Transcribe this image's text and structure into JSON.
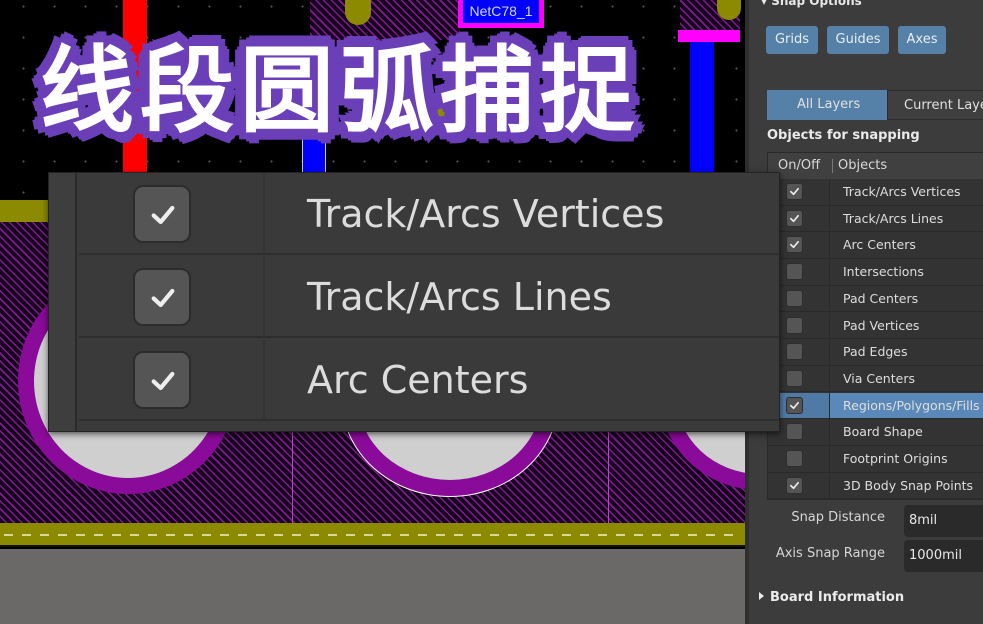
{
  "title_overlay": [
    "线",
    "段",
    "圆",
    "弧",
    "捕",
    "捉"
  ],
  "canvas": {
    "net_label": "NetC78_1",
    "colors": {
      "top_layer": "#ff0000",
      "bottom_layer": "#0000ff",
      "selection": "#ff00ff",
      "board_outline": "#8c8a00",
      "polygon": "#8a0a99"
    }
  },
  "panel": {
    "section_title": "Snap Options",
    "snap_buttons": [
      {
        "label": "Grids"
      },
      {
        "label": "Guides"
      },
      {
        "label": "Axes"
      }
    ],
    "layer_tabs": [
      {
        "label": "All Layers",
        "active": true
      },
      {
        "label": "Current Layer",
        "active": false
      }
    ],
    "objects_label": "Objects for snapping",
    "table": {
      "headers": [
        "On/Off",
        "Objects"
      ],
      "rows": [
        {
          "label": "Track/Arcs Vertices",
          "checked": true
        },
        {
          "label": "Track/Arcs Lines",
          "checked": true
        },
        {
          "label": "Arc Centers",
          "checked": true
        },
        {
          "label": "Intersections",
          "checked": false
        },
        {
          "label": "Pad Centers",
          "checked": false
        },
        {
          "label": "Pad Vertices",
          "checked": false
        },
        {
          "label": "Pad Edges",
          "checked": false
        },
        {
          "label": "Via Centers",
          "checked": false
        },
        {
          "label": "Regions/Polygons/Fills",
          "checked": true,
          "selected": true
        },
        {
          "label": "Board Shape",
          "checked": false
        },
        {
          "label": "Footprint Origins",
          "checked": false
        },
        {
          "label": "3D Body Snap Points",
          "checked": true
        }
      ]
    },
    "snap_distance": {
      "label": "Snap Distance",
      "value": "8mil"
    },
    "axis_snap_range": {
      "label": "Axis Snap Range",
      "value": "1000mil"
    },
    "board_information": "Board Information",
    "accent_color": "#5580a8"
  },
  "magnified": {
    "rows": [
      {
        "label": "Track/Arcs Vertices",
        "checked": true
      },
      {
        "label": "Track/Arcs Lines",
        "checked": true
      },
      {
        "label": "Arc Centers",
        "checked": true
      }
    ]
  }
}
